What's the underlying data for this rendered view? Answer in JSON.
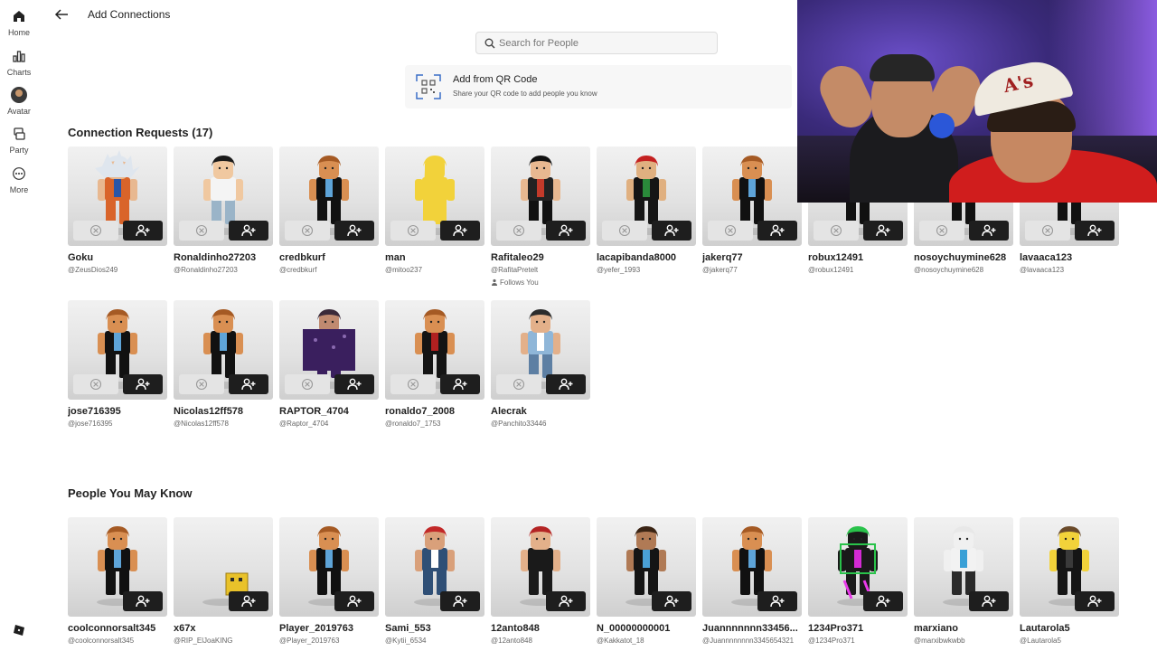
{
  "nav": {
    "items": [
      {
        "label": "Home",
        "icon": "home-icon"
      },
      {
        "label": "Charts",
        "icon": "charts-icon"
      },
      {
        "label": "Avatar",
        "icon": "avatar-icon"
      },
      {
        "label": "Party",
        "icon": "party-icon"
      },
      {
        "label": "More",
        "icon": "more-icon"
      }
    ]
  },
  "header": {
    "title": "Add Connections"
  },
  "search": {
    "placeholder": "Search for People"
  },
  "qr": {
    "title": "Add from QR Code",
    "subtitle": "Share your QR code to add people you know"
  },
  "requests": {
    "title": "Connection Requests (17)",
    "follows_label": "Follows You",
    "items": [
      {
        "name": "Goku",
        "handle": "@ZeusDios249",
        "look": "goku"
      },
      {
        "name": "Ronaldinho27203",
        "handle": "@Ronaldinho27203",
        "look": "white"
      },
      {
        "name": "credbkurf",
        "handle": "@credbkurf",
        "look": "default"
      },
      {
        "name": "man",
        "handle": "@mitoo237",
        "look": "banana"
      },
      {
        "name": "Rafitaleo29",
        "handle": "@RafitaPretelt",
        "follows": true,
        "look": "dark"
      },
      {
        "name": "lacapibanda8000",
        "handle": "@yefer_1993",
        "look": "suit"
      },
      {
        "name": "jakerq77",
        "handle": "@jakerq77",
        "look": "default"
      },
      {
        "name": "robux12491",
        "handle": "@robux12491",
        "look": "default"
      },
      {
        "name": "nosoychuymine628",
        "handle": "@nosoychuymine628",
        "look": "default"
      },
      {
        "name": "lavaaca123",
        "handle": "@lavaaca123",
        "look": "default"
      },
      {
        "name": "jose716395",
        "handle": "@jose716395",
        "look": "default"
      },
      {
        "name": "Nicolas12ff578",
        "handle": "@Nicolas12ff578",
        "look": "default"
      },
      {
        "name": "RAPTOR_4704",
        "handle": "@Raptor_4704",
        "look": "purple"
      },
      {
        "name": "ronaldo7_2008",
        "handle": "@ronaldo7_1753",
        "look": "black"
      },
      {
        "name": "Alecrak",
        "handle": "@Panchito33446",
        "look": "blue"
      }
    ]
  },
  "suggestions": {
    "title": "People You May Know",
    "items": [
      {
        "name": "coolconnorsalt345",
        "handle": "@coolconnorsalt345",
        "look": "default"
      },
      {
        "name": "x67x",
        "handle": "@RIP_ElJoaKING",
        "look": "box"
      },
      {
        "name": "Player_2019763",
        "handle": "@Player_2019763",
        "look": "default"
      },
      {
        "name": "Sami_553",
        "handle": "@Kytii_6534",
        "look": "red"
      },
      {
        "name": "12anto848",
        "handle": "@12anto848",
        "look": "hood"
      },
      {
        "name": "N_00000000001",
        "handle": "@Kakkatot_18",
        "look": "brown"
      },
      {
        "name": "Juannnnnnn33456...",
        "handle": "@Juannnnnnnn3345654321",
        "look": "default"
      },
      {
        "name": "1234Pro371",
        "handle": "@1234Pro371",
        "look": "neon"
      },
      {
        "name": "marxiano",
        "handle": "@marxibwkwbb",
        "look": "mask"
      },
      {
        "name": "Lautarola5",
        "handle": "@Lautarola5",
        "look": "smile"
      }
    ]
  },
  "colors": {
    "accent": "#1e1e1e",
    "decline": "#e4e4e4",
    "card_bg": "#e6e6e6"
  }
}
